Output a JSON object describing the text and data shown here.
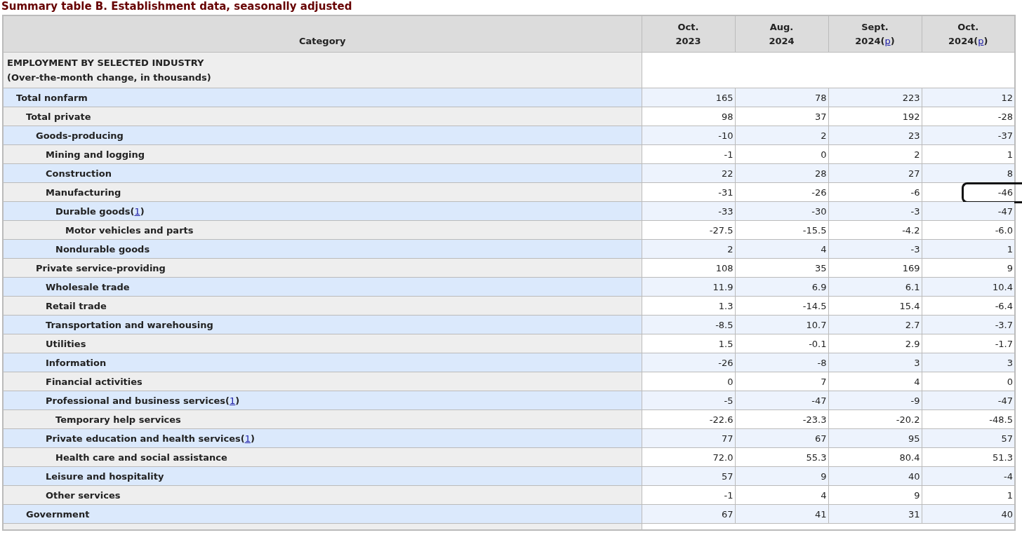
{
  "title": "Summary table B. Establishment data, seasonally adjusted",
  "table": {
    "columns": [
      {
        "label": "Category"
      },
      {
        "lines": [
          "Oct.",
          "2023"
        ]
      },
      {
        "lines": [
          "Aug.",
          "2024"
        ]
      },
      {
        "lines": [
          "Sept.",
          "2024"
        ],
        "note": {
          "pre": "(",
          "link": "p",
          "post": ")"
        }
      },
      {
        "lines": [
          "Oct.",
          "2024"
        ],
        "note": {
          "pre": "(",
          "link": "p",
          "post": ")"
        }
      }
    ],
    "section": {
      "lines": [
        "EMPLOYMENT BY SELECTED INDUSTRY",
        "(Over-the-month change, in thousands)"
      ]
    },
    "rows": [
      {
        "label": "Total nonfarm",
        "values": [
          {
            "text": "165",
            "circled": false
          },
          {
            "text": "78",
            "circled": false
          },
          {
            "text": "223",
            "circled": false
          },
          {
            "text": "12",
            "circled": false
          }
        ],
        "children": [
          {
            "label": "Total private",
            "values": [
              {
                "text": "98",
                "circled": false
              },
              {
                "text": "37",
                "circled": false
              },
              {
                "text": "192",
                "circled": false
              },
              {
                "text": "-28",
                "circled": false
              }
            ],
            "children": [
              {
                "label": "Goods-producing",
                "values": [
                  {
                    "text": "-10",
                    "circled": false
                  },
                  {
                    "text": "2",
                    "circled": false
                  },
                  {
                    "text": "23",
                    "circled": false
                  },
                  {
                    "text": "-37",
                    "circled": false
                  }
                ],
                "children": [
                  {
                    "label": "Mining and logging",
                    "values": [
                      {
                        "text": "-1",
                        "circled": false
                      },
                      {
                        "text": "0",
                        "circled": false
                      },
                      {
                        "text": "2",
                        "circled": false
                      },
                      {
                        "text": "1",
                        "circled": false
                      }
                    ]
                  },
                  {
                    "label": "Construction",
                    "values": [
                      {
                        "text": "22",
                        "circled": false
                      },
                      {
                        "text": "28",
                        "circled": false
                      },
                      {
                        "text": "27",
                        "circled": false
                      },
                      {
                        "text": "8",
                        "circled": false
                      }
                    ]
                  },
                  {
                    "label": "Manufacturing",
                    "values": [
                      {
                        "text": "-31",
                        "circled": false
                      },
                      {
                        "text": "-26",
                        "circled": false
                      },
                      {
                        "text": "-6",
                        "circled": false
                      },
                      {
                        "text": "-46",
                        "circled": true
                      }
                    ],
                    "children": [
                      {
                        "label": "Durable goods",
                        "note": {
                          "pre": "(",
                          "link": "1",
                          "post": ")"
                        },
                        "values": [
                          {
                            "text": "-33",
                            "circled": false
                          },
                          {
                            "text": "-30",
                            "circled": false
                          },
                          {
                            "text": "-3",
                            "circled": false
                          },
                          {
                            "text": "-47",
                            "circled": false
                          }
                        ],
                        "children": [
                          {
                            "label": "Motor vehicles and parts",
                            "values": [
                              {
                                "text": "-27.5",
                                "circled": false
                              },
                              {
                                "text": "-15.5",
                                "circled": false
                              },
                              {
                                "text": "-4.2",
                                "circled": false
                              },
                              {
                                "text": "-6.0",
                                "circled": false
                              }
                            ]
                          }
                        ]
                      },
                      {
                        "label": "Nondurable goods",
                        "values": [
                          {
                            "text": "2",
                            "circled": false
                          },
                          {
                            "text": "4",
                            "circled": false
                          },
                          {
                            "text": "-3",
                            "circled": false
                          },
                          {
                            "text": "1",
                            "circled": false
                          }
                        ]
                      }
                    ]
                  }
                ]
              },
              {
                "label": "Private service-providing",
                "values": [
                  {
                    "text": "108",
                    "circled": false
                  },
                  {
                    "text": "35",
                    "circled": false
                  },
                  {
                    "text": "169",
                    "circled": false
                  },
                  {
                    "text": "9",
                    "circled": false
                  }
                ],
                "children": [
                  {
                    "label": "Wholesale trade",
                    "values": [
                      {
                        "text": "11.9",
                        "circled": false
                      },
                      {
                        "text": "6.9",
                        "circled": false
                      },
                      {
                        "text": "6.1",
                        "circled": false
                      },
                      {
                        "text": "10.4",
                        "circled": false
                      }
                    ]
                  },
                  {
                    "label": "Retail trade",
                    "values": [
                      {
                        "text": "1.3",
                        "circled": false
                      },
                      {
                        "text": "-14.5",
                        "circled": false
                      },
                      {
                        "text": "15.4",
                        "circled": false
                      },
                      {
                        "text": "-6.4",
                        "circled": false
                      }
                    ]
                  },
                  {
                    "label": "Transportation and warehousing",
                    "values": [
                      {
                        "text": "-8.5",
                        "circled": false
                      },
                      {
                        "text": "10.7",
                        "circled": false
                      },
                      {
                        "text": "2.7",
                        "circled": false
                      },
                      {
                        "text": "-3.7",
                        "circled": false
                      }
                    ]
                  },
                  {
                    "label": "Utilities",
                    "values": [
                      {
                        "text": "1.5",
                        "circled": false
                      },
                      {
                        "text": "-0.1",
                        "circled": false
                      },
                      {
                        "text": "2.9",
                        "circled": false
                      },
                      {
                        "text": "-1.7",
                        "circled": false
                      }
                    ]
                  },
                  {
                    "label": "Information",
                    "values": [
                      {
                        "text": "-26",
                        "circled": false
                      },
                      {
                        "text": "-8",
                        "circled": false
                      },
                      {
                        "text": "3",
                        "circled": false
                      },
                      {
                        "text": "3",
                        "circled": false
                      }
                    ]
                  },
                  {
                    "label": "Financial activities",
                    "values": [
                      {
                        "text": "0",
                        "circled": false
                      },
                      {
                        "text": "7",
                        "circled": false
                      },
                      {
                        "text": "4",
                        "circled": false
                      },
                      {
                        "text": "0",
                        "circled": false
                      }
                    ]
                  },
                  {
                    "label": "Professional and business services",
                    "note": {
                      "pre": "(",
                      "link": "1",
                      "post": ")"
                    },
                    "values": [
                      {
                        "text": "-5",
                        "circled": false
                      },
                      {
                        "text": "-47",
                        "circled": false
                      },
                      {
                        "text": "-9",
                        "circled": false
                      },
                      {
                        "text": "-47",
                        "circled": false
                      }
                    ],
                    "children": [
                      {
                        "label": "Temporary help services",
                        "values": [
                          {
                            "text": "-22.6",
                            "circled": false
                          },
                          {
                            "text": "-23.3",
                            "circled": false
                          },
                          {
                            "text": "-20.2",
                            "circled": false
                          },
                          {
                            "text": "-48.5",
                            "circled": false
                          }
                        ]
                      }
                    ]
                  },
                  {
                    "label": "Private education and health services",
                    "note": {
                      "pre": "(",
                      "link": "1",
                      "post": ")"
                    },
                    "values": [
                      {
                        "text": "77",
                        "circled": false
                      },
                      {
                        "text": "67",
                        "circled": false
                      },
                      {
                        "text": "95",
                        "circled": false
                      },
                      {
                        "text": "57",
                        "circled": false
                      }
                    ],
                    "children": [
                      {
                        "label": "Health care and social assistance",
                        "values": [
                          {
                            "text": "72.0",
                            "circled": false
                          },
                          {
                            "text": "55.3",
                            "circled": false
                          },
                          {
                            "text": "80.4",
                            "circled": false
                          },
                          {
                            "text": "51.3",
                            "circled": false
                          }
                        ]
                      }
                    ]
                  },
                  {
                    "label": "Leisure and hospitality",
                    "values": [
                      {
                        "text": "57",
                        "circled": false
                      },
                      {
                        "text": "9",
                        "circled": false
                      },
                      {
                        "text": "40",
                        "circled": false
                      },
                      {
                        "text": "-4",
                        "circled": false
                      }
                    ]
                  },
                  {
                    "label": "Other services",
                    "values": [
                      {
                        "text": "-1",
                        "circled": false
                      },
                      {
                        "text": "4",
                        "circled": false
                      },
                      {
                        "text": "9",
                        "circled": false
                      },
                      {
                        "text": "1",
                        "circled": false
                      }
                    ]
                  }
                ]
              }
            ]
          },
          {
            "label": "Government",
            "values": [
              {
                "text": "67",
                "circled": false
              },
              {
                "text": "41",
                "circled": false
              },
              {
                "text": "31",
                "circled": false
              },
              {
                "text": "40",
                "circled": false
              }
            ]
          }
        ]
      }
    ]
  }
}
